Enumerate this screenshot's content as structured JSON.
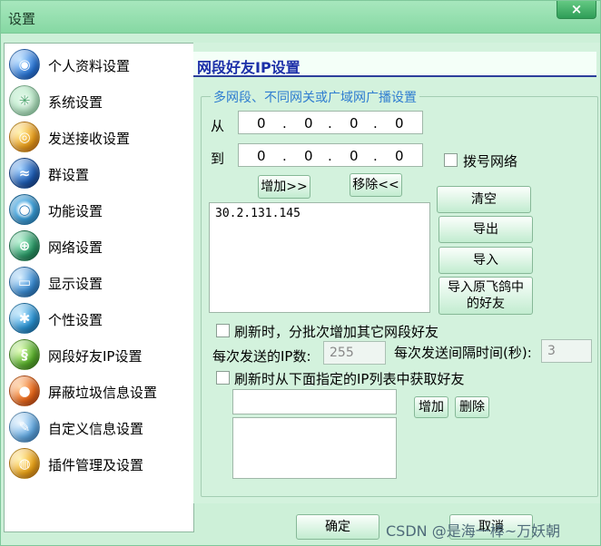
{
  "window": {
    "title": "设置",
    "close_glyph": "×"
  },
  "sidebar": {
    "items": [
      {
        "label": "个人资料设置",
        "icon": "globe-blue-icon",
        "color": "#2a7ae0"
      },
      {
        "label": "系统设置",
        "icon": "sparkle-green-icon",
        "color": "#9be0b4"
      },
      {
        "label": "发送接收设置",
        "icon": "orange-orb-icon",
        "color": "#f0a21c"
      },
      {
        "label": "群设置",
        "icon": "blue-globe-swoosh-icon",
        "color": "#1f5fb8"
      },
      {
        "label": "功能设置",
        "icon": "blue-ring-icon",
        "color": "#3da4e0"
      },
      {
        "label": "网络设置",
        "icon": "network-globe-icon",
        "color": "#2c9d6a"
      },
      {
        "label": "显示设置",
        "icon": "display-orb-icon",
        "color": "#3b8fd8"
      },
      {
        "label": "个性设置",
        "icon": "star-orb-icon",
        "color": "#2a96d8"
      },
      {
        "label": "网段好友IP设置",
        "icon": "green-swirl-icon",
        "color": "#5cb52e"
      },
      {
        "label": "屏蔽垃圾信息设置",
        "icon": "red-orange-orb-icon",
        "color": "#ef6a1a"
      },
      {
        "label": "自定义信息设置",
        "icon": "pencil-orb-icon",
        "color": "#66aee8"
      },
      {
        "label": "插件管理及设置",
        "icon": "plugin-orb-icon",
        "color": "#f2a819"
      }
    ]
  },
  "panel": {
    "title": "网段好友IP设置",
    "group_legend": "多网段、不同网关或广域网广播设置",
    "from_label": "从",
    "to_label": "到",
    "from_ip": [
      "0",
      "0",
      "0",
      "0"
    ],
    "to_ip": [
      "0",
      "0",
      "0",
      "0"
    ],
    "ip_dot": ".",
    "dialup_label": "拨号网络",
    "add_btn": "增加>>",
    "remove_btn": "移除<<",
    "ip_list": [
      "30.2.131.145"
    ],
    "clear_btn": "清空",
    "export_btn": "导出",
    "import_btn": "导入",
    "import_old_line1": "导入原飞鸽中",
    "import_old_line2": "的好友",
    "refresh_batch_label": "刷新时，分批次增加其它网段好友",
    "per_send_ip_label": "每次发送的IP数:",
    "per_send_ip_value": "255",
    "interval_label": "每次发送间隔时间(秒):",
    "interval_value": "3",
    "refresh_from_list_label": "刷新时从下面指定的IP列表中获取好友",
    "add_small_btn": "增加",
    "delete_small_btn": "删除"
  },
  "footer": {
    "ok_btn": "确定",
    "cancel_btn": "取消",
    "watermark": "CSDN @是海一棒~万妖朝"
  }
}
